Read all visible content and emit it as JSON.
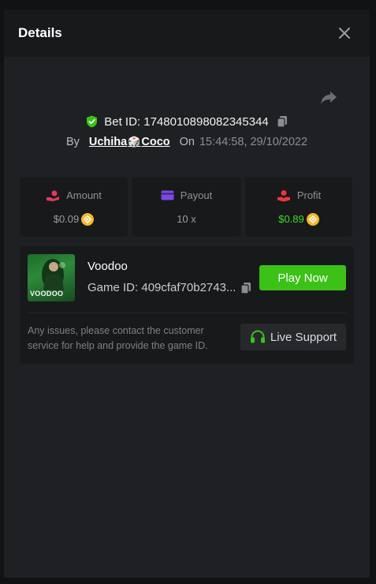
{
  "modal": {
    "title": "Details"
  },
  "bet": {
    "id_text": "Bet ID: 1748010898082345344",
    "by_label": "By",
    "user_name": "Uchiha",
    "user_dice": "🎲",
    "user_name_suffix": "Coco",
    "on_label": "On",
    "timestamp": "15:44:58, 29/10/2022"
  },
  "stats": {
    "amount": {
      "label": "Amount",
      "value": "$0.09"
    },
    "payout": {
      "label": "Payout",
      "value": "10 x"
    },
    "profit": {
      "label": "Profit",
      "value": "$0.89"
    }
  },
  "game": {
    "name": "Voodoo",
    "thumb_title": "VOODOO",
    "id_text": "Game ID: 409cfaf70b2743...",
    "play_label": "Play Now"
  },
  "support": {
    "issue_text": "Any issues, please contact the customer service for help and provide the game ID.",
    "button_label": "Live Support"
  },
  "colors": {
    "accent_green": "#3bc117",
    "profit_green": "#3ddc2c",
    "amount_pink": "#e8365d",
    "payout_purple": "#7b4ae2",
    "profit_red": "#e8363c",
    "coin_gold": "#f3ba2f"
  },
  "icons": {
    "close": "close-icon",
    "share": "share-icon",
    "shield": "shield-check-icon",
    "copy": "copy-icon",
    "amount": "hand-coin-icon",
    "payout": "card-icon",
    "profit": "profit-hand-icon",
    "coin": "bnb-coin-icon",
    "headset": "headset-icon"
  }
}
